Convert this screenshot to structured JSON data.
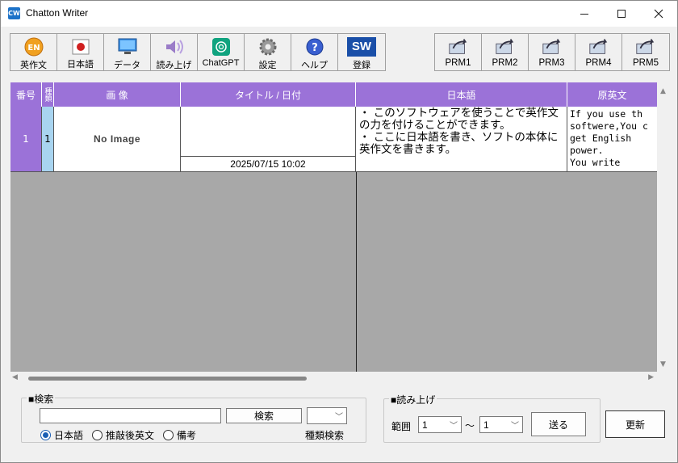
{
  "window": {
    "title": "Chatton Writer",
    "app_icon_text": "CW"
  },
  "toolbar": {
    "buttons": [
      {
        "label": "英作文",
        "icon": "en-badge-icon"
      },
      {
        "label": "日本語",
        "icon": "japan-flag-icon"
      },
      {
        "label": "データ",
        "icon": "monitor-data-icon"
      },
      {
        "label": "読み上げ",
        "icon": "speaker-icon"
      },
      {
        "label": "ChatGPT",
        "icon": "chatgpt-icon"
      },
      {
        "label": "設定",
        "icon": "gear-icon"
      },
      {
        "label": "ヘルプ",
        "icon": "help-icon"
      },
      {
        "label": "登録",
        "icon": "sw-register-icon",
        "icon_text": "SW"
      }
    ],
    "prm_buttons": [
      {
        "label": "PRM1",
        "icon": "share-prm-icon"
      },
      {
        "label": "PRM2",
        "icon": "share-prm-icon"
      },
      {
        "label": "PRM3",
        "icon": "share-prm-icon"
      },
      {
        "label": "PRM4",
        "icon": "share-prm-icon"
      },
      {
        "label": "PRM5",
        "icon": "share-prm-icon"
      }
    ]
  },
  "grid": {
    "headers": {
      "number": "番号",
      "kind": "種類",
      "image": "画 像",
      "title_date": "タイトル / 日付",
      "japanese": "日本語",
      "original_english": "原英文"
    },
    "rows": [
      {
        "number": "1",
        "kind": "1",
        "image_text": "No Image",
        "title": "",
        "date": "2025/07/15 10:02",
        "japanese": "・ このソフトウェアを使うことで英作文の力を付けることができます。\n・ ここに日本語を書き、ソフトの本体に英作文を書きます。",
        "english": "If you use th\nsoftwere,You c\nget English\npower.\nYou write"
      }
    ]
  },
  "search": {
    "group_label": "■検索",
    "input_value": "",
    "search_button": "検索",
    "kind_select_value": "",
    "kind_search_label": "種類検索",
    "radio_options": [
      {
        "label": "日本語",
        "checked": true
      },
      {
        "label": "推敲後英文",
        "checked": false
      },
      {
        "label": "備考",
        "checked": false
      }
    ]
  },
  "readaloud": {
    "group_label": "■読み上げ",
    "range_label": "範囲",
    "from_value": "1",
    "tilde": "～",
    "to_value": "1",
    "send_button": "送る"
  },
  "refresh_button": "更新",
  "colors": {
    "header_purple": "#9b72d8",
    "kind_blue": "#a8d4f0",
    "grid_gray": "#a8a8a8"
  }
}
